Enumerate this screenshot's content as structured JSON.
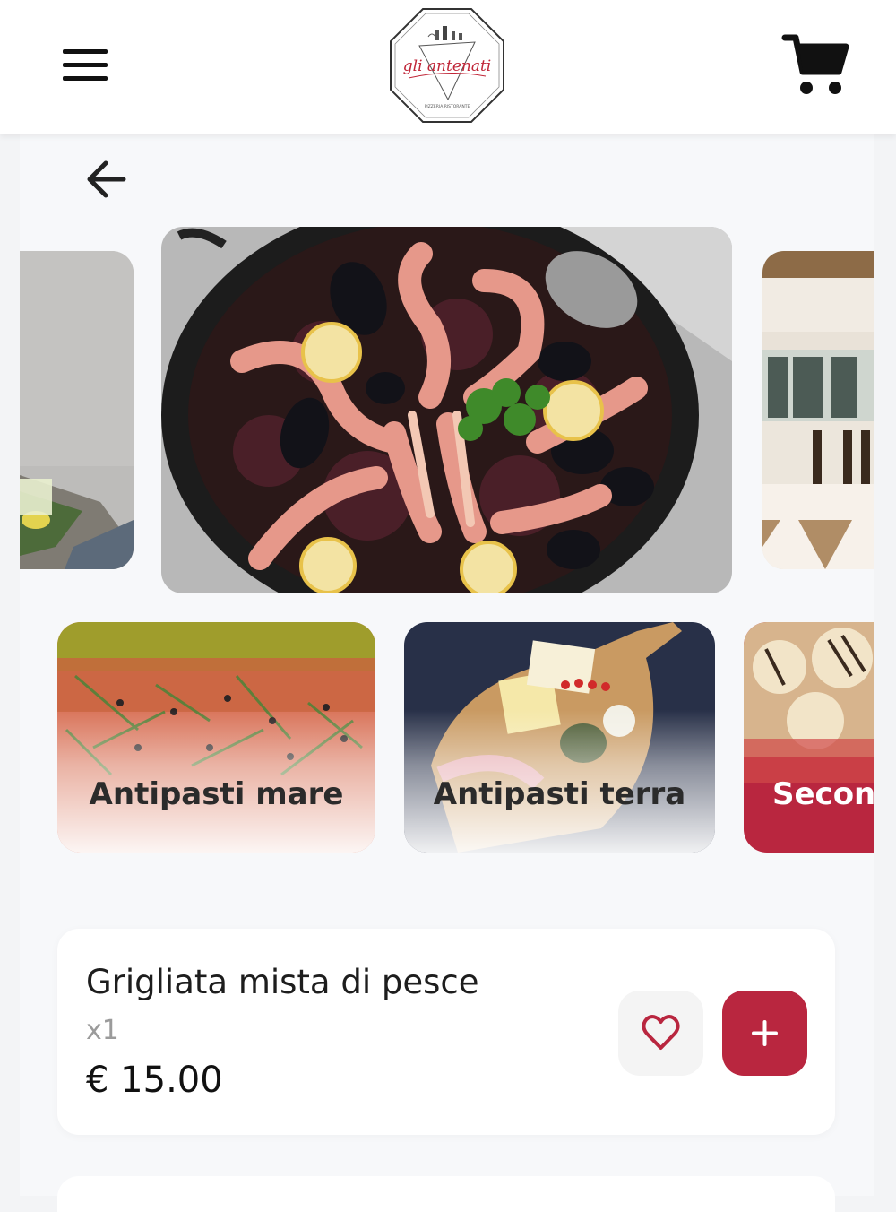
{
  "header": {
    "logo_text": "gli antenati",
    "logo_subtext": "PIZZERIA RISTORANTE",
    "menu_icon": "hamburger-menu-icon",
    "cart_icon": "shopping-cart-icon"
  },
  "navigation": {
    "back_icon": "arrow-left-icon"
  },
  "carousel": {
    "slides": [
      {
        "image": "table-setting-photo"
      },
      {
        "image": "seafood-black-rice-paella-photo"
      },
      {
        "image": "restaurant-dining-room-photo"
      }
    ]
  },
  "categories": [
    {
      "label": "Antipasti mare",
      "image": "salmon-carpaccio-photo"
    },
    {
      "label": "Antipasti terra",
      "image": "cheese-board-photo"
    },
    {
      "label": "Secon",
      "image": "grilled-fish-photo"
    }
  ],
  "product": {
    "name": "Grigliata mista di pesce",
    "quantity": "x1",
    "price": "€ 15.00",
    "favorite_icon": "heart-icon",
    "add_icon": "plus-icon"
  },
  "colors": {
    "accent": "#b9263f",
    "background": "#f7f8fa",
    "card": "#ffffff"
  }
}
